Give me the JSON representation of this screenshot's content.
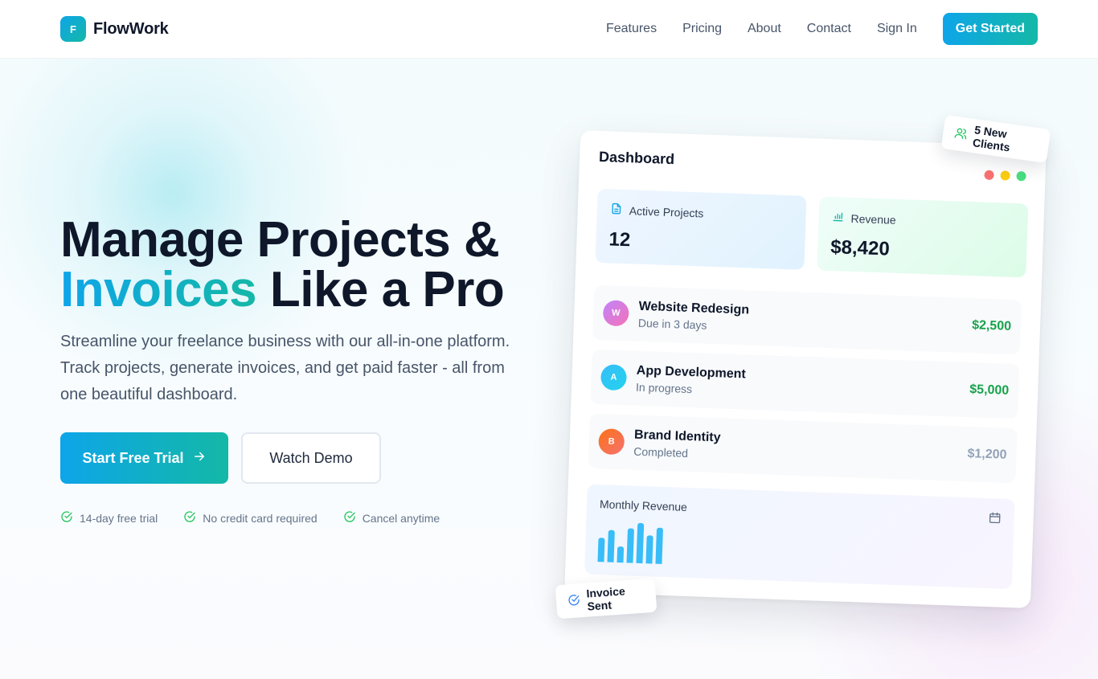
{
  "nav": {
    "brand_mark": "F",
    "brand_name": "FlowWork",
    "links": [
      "Features",
      "Pricing",
      "About",
      "Contact"
    ],
    "sign_in": "Sign In",
    "cta": "Get Started"
  },
  "hero": {
    "title_line1": "Manage Projects &",
    "title_highlight": "Invoices",
    "title_line2_rest": " Like a Pro",
    "subtitle": "Streamline your freelance business with our all-in-one platform. Track projects, generate invoices, and get paid faster - all from one beautiful dashboard.",
    "primary_button": "Start Free Trial",
    "secondary_button": "Watch Demo",
    "perks": [
      "14-day free trial",
      "No credit card required",
      "Cancel anytime"
    ]
  },
  "dashboard": {
    "title": "Dashboard",
    "stats": [
      {
        "label": "Active Projects",
        "value": "12"
      },
      {
        "label": "Revenue",
        "value": "$8,420"
      }
    ],
    "projects": [
      {
        "initial": "W",
        "name": "Website Redesign",
        "status": "Due in 3 days",
        "amount": "$2,500",
        "amount_color": "#16a34a",
        "avatar_colors": [
          "#c084fc",
          "#f472b6"
        ]
      },
      {
        "initial": "A",
        "name": "App Development",
        "status": "In progress",
        "amount": "$5,000",
        "amount_color": "#16a34a",
        "avatar_colors": [
          "#38bdf8",
          "#22d3ee"
        ]
      },
      {
        "initial": "B",
        "name": "Brand Identity",
        "status": "Completed",
        "amount": "$1,200",
        "amount_color": "#94a3b8",
        "avatar_colors": [
          "#f97316",
          "#f87171"
        ]
      }
    ],
    "chart_title": "Monthly Revenue",
    "chart_bars": [
      0.6,
      0.8,
      0.4,
      0.85,
      1.0,
      0.7,
      0.9
    ],
    "window_dots": [
      "#f87171",
      "#facc15",
      "#4ade80"
    ]
  },
  "badges": {
    "clients": "5 New Clients",
    "invoice": "Invoice Sent"
  },
  "colors": {
    "accent_start": "#0ea5e9",
    "accent_end": "#14b8a6",
    "success": "#22c55e"
  }
}
